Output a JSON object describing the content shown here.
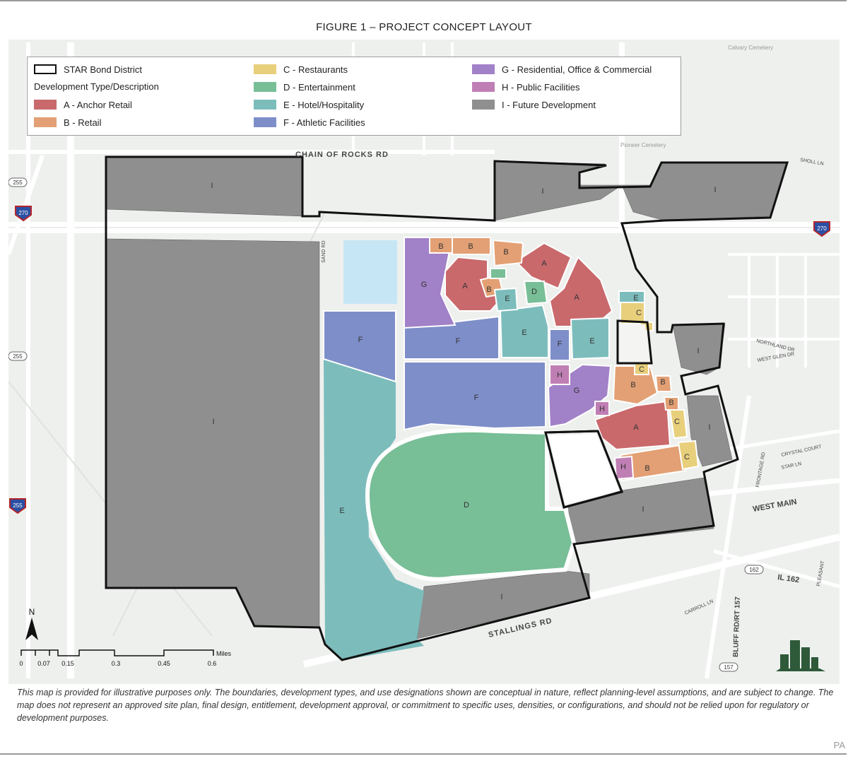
{
  "figure_title": "FIGURE 1 – PROJECT CONCEPT LAYOUT",
  "legend": {
    "district_label": "STAR Bond District",
    "subtitle": "Development Type/Description",
    "items": [
      {
        "code": "A",
        "label": "A - Anchor Retail",
        "color": "#c9696c"
      },
      {
        "code": "B",
        "label": "B - Retail",
        "color": "#e3a074"
      },
      {
        "code": "C",
        "label": "C - Restaurants",
        "color": "#e8cf7c"
      },
      {
        "code": "D",
        "label": "D - Entertainment",
        "color": "#78be96"
      },
      {
        "code": "E",
        "label": "E - Hotel/Hospitality",
        "color": "#7cbdbc"
      },
      {
        "code": "F",
        "label": "F - Athletic Facilities",
        "color": "#7e8ec9"
      },
      {
        "code": "G",
        "label": "G - Residential, Office & Commercial",
        "color": "#a181c7"
      },
      {
        "code": "H",
        "label": "H - Public Facilities",
        "color": "#c07fb4"
      },
      {
        "code": "I",
        "label": "I - Future Development",
        "color": "#8f8f8f"
      }
    ]
  },
  "parcel_labels": {
    "I": "I",
    "A": "A",
    "B": "B",
    "C": "C",
    "D": "D",
    "E": "E",
    "F": "F",
    "G": "G",
    "H": "H"
  },
  "road_labels": {
    "chain_of_rocks": "CHAIN OF ROCKS RD",
    "stallings": "STALLINGS RD",
    "west_main": "WEST MAIN",
    "bluff": "BLUFF RD/RT 157",
    "il162": "IL 162",
    "sand_rd": "SAND RD",
    "crystal_court": "CRYSTAL COURT",
    "star_ln": "STAR LN",
    "west_glen": "WEST GLEN DR",
    "northland": "NORTHLAND DR",
    "sholl_ln": "SHOLL LN",
    "pioneer": "Pioneer Cemetery",
    "calvary": "Calvary Cemetery",
    "frontage": "FRONTAGE RD",
    "carroll": "CARROLL LN",
    "pleasant": "PLEASANT"
  },
  "shields": {
    "i270": "270",
    "i255": "255",
    "r255": "255",
    "r162": "162",
    "r157": "157"
  },
  "scale": {
    "ticks": [
      "0",
      "0.07",
      "0.15",
      "0.3",
      "0.45",
      "0.6"
    ],
    "unit": "Miles",
    "north": "N"
  },
  "disclaimer": "This map is provided for illustrative purposes only. The boundaries, development types, and use designations shown are conceptual in nature, reflect planning-level assumptions, and are subject to change. The map does not represent an approved site plan, final design, entitlement, development approval, or commitment to specific uses, densities, or configurations, and should not be relied upon for regulatory or development purposes.",
  "page_mark": "PA"
}
